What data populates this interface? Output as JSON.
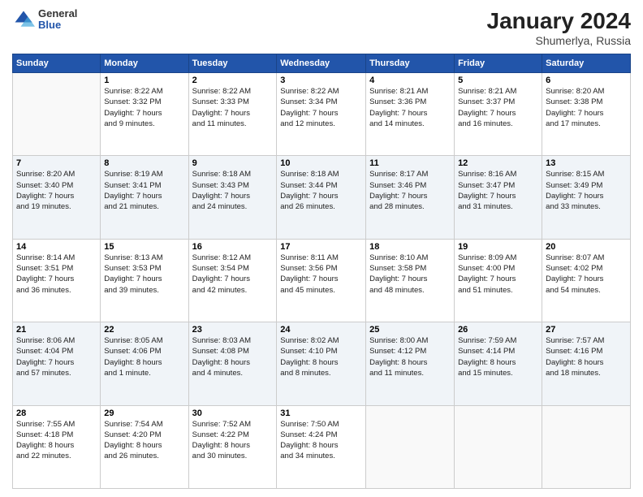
{
  "header": {
    "logo": {
      "general": "General",
      "blue": "Blue"
    },
    "title": "January 2024",
    "subtitle": "Shumerlya, Russia"
  },
  "days_of_week": [
    "Sunday",
    "Monday",
    "Tuesday",
    "Wednesday",
    "Thursday",
    "Friday",
    "Saturday"
  ],
  "weeks": [
    [
      {
        "num": "",
        "info": ""
      },
      {
        "num": "1",
        "info": "Sunrise: 8:22 AM\nSunset: 3:32 PM\nDaylight: 7 hours\nand 9 minutes."
      },
      {
        "num": "2",
        "info": "Sunrise: 8:22 AM\nSunset: 3:33 PM\nDaylight: 7 hours\nand 11 minutes."
      },
      {
        "num": "3",
        "info": "Sunrise: 8:22 AM\nSunset: 3:34 PM\nDaylight: 7 hours\nand 12 minutes."
      },
      {
        "num": "4",
        "info": "Sunrise: 8:21 AM\nSunset: 3:36 PM\nDaylight: 7 hours\nand 14 minutes."
      },
      {
        "num": "5",
        "info": "Sunrise: 8:21 AM\nSunset: 3:37 PM\nDaylight: 7 hours\nand 16 minutes."
      },
      {
        "num": "6",
        "info": "Sunrise: 8:20 AM\nSunset: 3:38 PM\nDaylight: 7 hours\nand 17 minutes."
      }
    ],
    [
      {
        "num": "7",
        "info": ""
      },
      {
        "num": "8",
        "info": "Sunrise: 8:19 AM\nSunset: 3:41 PM\nDaylight: 7 hours\nand 21 minutes."
      },
      {
        "num": "9",
        "info": "Sunrise: 8:18 AM\nSunset: 3:43 PM\nDaylight: 7 hours\nand 24 minutes."
      },
      {
        "num": "10",
        "info": "Sunrise: 8:18 AM\nSunset: 3:44 PM\nDaylight: 7 hours\nand 26 minutes."
      },
      {
        "num": "11",
        "info": "Sunrise: 8:17 AM\nSunset: 3:46 PM\nDaylight: 7 hours\nand 28 minutes."
      },
      {
        "num": "12",
        "info": "Sunrise: 8:16 AM\nSunset: 3:47 PM\nDaylight: 7 hours\nand 31 minutes."
      },
      {
        "num": "13",
        "info": "Sunrise: 8:15 AM\nSunset: 3:49 PM\nDaylight: 7 hours\nand 33 minutes."
      }
    ],
    [
      {
        "num": "14",
        "info": ""
      },
      {
        "num": "15",
        "info": "Sunrise: 8:13 AM\nSunset: 3:53 PM\nDaylight: 7 hours\nand 39 minutes."
      },
      {
        "num": "16",
        "info": "Sunrise: 8:12 AM\nSunset: 3:54 PM\nDaylight: 7 hours\nand 42 minutes."
      },
      {
        "num": "17",
        "info": "Sunrise: 8:11 AM\nSunset: 3:56 PM\nDaylight: 7 hours\nand 45 minutes."
      },
      {
        "num": "18",
        "info": "Sunrise: 8:10 AM\nSunset: 3:58 PM\nDaylight: 7 hours\nand 48 minutes."
      },
      {
        "num": "19",
        "info": "Sunrise: 8:09 AM\nSunset: 4:00 PM\nDaylight: 7 hours\nand 51 minutes."
      },
      {
        "num": "20",
        "info": "Sunrise: 8:07 AM\nSunset: 4:02 PM\nDaylight: 7 hours\nand 54 minutes."
      }
    ],
    [
      {
        "num": "21",
        "info": ""
      },
      {
        "num": "22",
        "info": "Sunrise: 8:05 AM\nSunset: 4:06 PM\nDaylight: 8 hours\nand 1 minute."
      },
      {
        "num": "23",
        "info": "Sunrise: 8:03 AM\nSunset: 4:08 PM\nDaylight: 8 hours\nand 4 minutes."
      },
      {
        "num": "24",
        "info": "Sunrise: 8:02 AM\nSunset: 4:10 PM\nDaylight: 8 hours\nand 8 minutes."
      },
      {
        "num": "25",
        "info": "Sunrise: 8:00 AM\nSunset: 4:12 PM\nDaylight: 8 hours\nand 11 minutes."
      },
      {
        "num": "26",
        "info": "Sunrise: 7:59 AM\nSunset: 4:14 PM\nDaylight: 8 hours\nand 15 minutes."
      },
      {
        "num": "27",
        "info": "Sunrise: 7:57 AM\nSunset: 4:16 PM\nDaylight: 8 hours\nand 18 minutes."
      }
    ],
    [
      {
        "num": "28",
        "info": "Sunrise: 7:55 AM\nSunset: 4:18 PM\nDaylight: 8 hours\nand 22 minutes."
      },
      {
        "num": "29",
        "info": "Sunrise: 7:54 AM\nSunset: 4:20 PM\nDaylight: 8 hours\nand 26 minutes."
      },
      {
        "num": "30",
        "info": "Sunrise: 7:52 AM\nSunset: 4:22 PM\nDaylight: 8 hours\nand 30 minutes."
      },
      {
        "num": "31",
        "info": "Sunrise: 7:50 AM\nSunset: 4:24 PM\nDaylight: 8 hours\nand 34 minutes."
      },
      {
        "num": "",
        "info": ""
      },
      {
        "num": "",
        "info": ""
      },
      {
        "num": "",
        "info": ""
      }
    ]
  ],
  "week7_sunday": "Sunrise: 8:20 AM\nSunset: 3:40 PM\nDaylight: 7 hours\nand 19 minutes.",
  "week14_sunday": "Sunrise: 8:14 AM\nSunset: 3:51 PM\nDaylight: 7 hours\nand 36 minutes.",
  "week21_sunday": "Sunrise: 8:06 AM\nSunset: 4:04 PM\nDaylight: 7 hours\nand 57 minutes."
}
